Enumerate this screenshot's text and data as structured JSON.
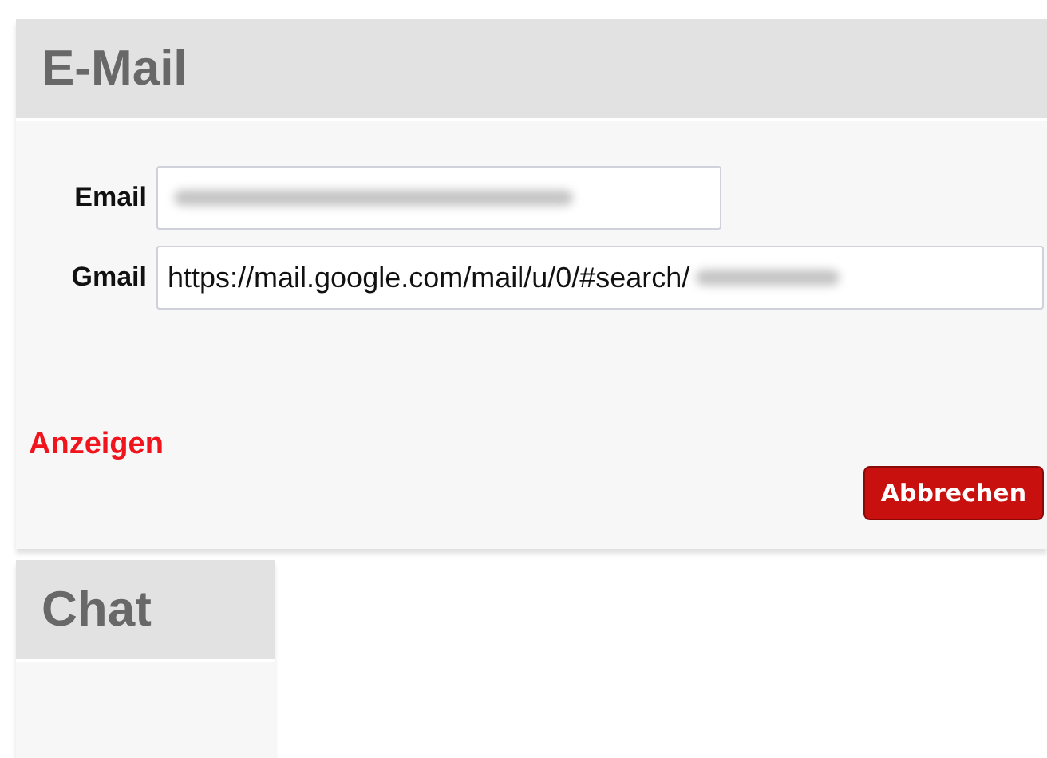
{
  "email_panel": {
    "title": "E-Mail",
    "fields": [
      {
        "label": "Email",
        "redacted": true
      },
      {
        "label": "Gmail",
        "value": "https://mail.google.com/mail/u/0/#search/",
        "redacted": true
      }
    ],
    "link": "Anzeigen",
    "button": "Abbrechen"
  },
  "chat_panel": {
    "title": "Chat"
  }
}
